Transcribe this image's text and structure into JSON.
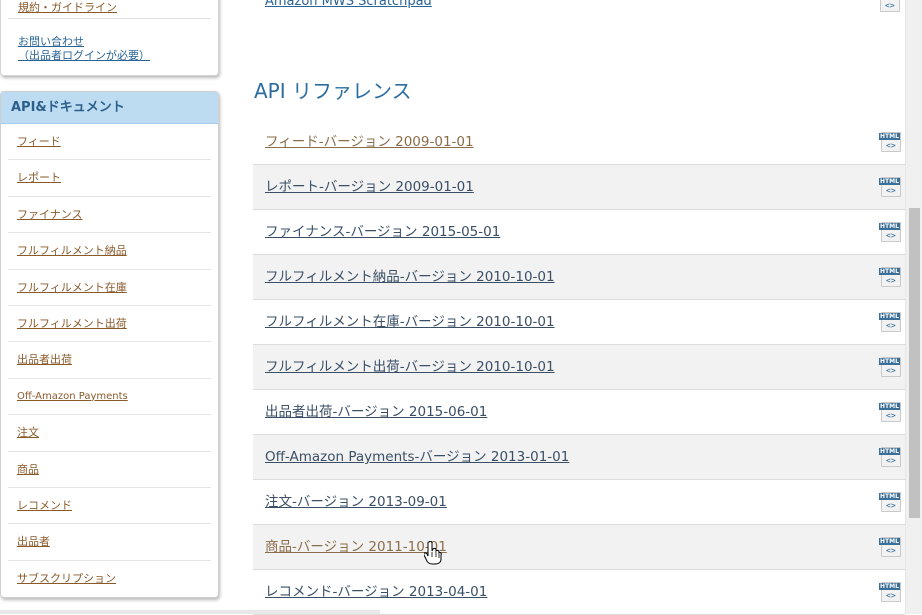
{
  "sidebar": {
    "top_link": "規約・ガイドライン",
    "contact_line1": "お問い合わせ",
    "contact_line2": "（出品者ログインが必要）",
    "section_title": "API&ドキュメント",
    "items": [
      {
        "label": "フィード"
      },
      {
        "label": "レポート"
      },
      {
        "label": "ファイナンス"
      },
      {
        "label": "フルフィルメント納品"
      },
      {
        "label": "フルフィルメント在庫"
      },
      {
        "label": "フルフィルメント出荷"
      },
      {
        "label": "出品者出荷"
      },
      {
        "label": "Off-Amazon Payments"
      },
      {
        "label": "注文"
      },
      {
        "label": "商品"
      },
      {
        "label": "レコメンド"
      },
      {
        "label": "出品者"
      },
      {
        "label": "サブスクリプション"
      }
    ]
  },
  "main": {
    "prev_link": "Amazon MWS Scratchpad",
    "section_title": "API リファレンス",
    "icon_tag": "HTML",
    "icon_code": "<>",
    "api_list": [
      {
        "label": "フィード-バージョン 2009-01-01"
      },
      {
        "label": "レポート-バージョン 2009-01-01"
      },
      {
        "label": "ファイナンス-バージョン 2015-05-01"
      },
      {
        "label": "フルフィルメント納品-バージョン 2010-10-01"
      },
      {
        "label": "フルフィルメント在庫-バージョン 2010-10-01"
      },
      {
        "label": "フルフィルメント出荷-バージョン 2010-10-01"
      },
      {
        "label": "出品者出荷-バージョン 2015-06-01"
      },
      {
        "label": "Off-Amazon Payments-バージョン 2013-01-01"
      },
      {
        "label": "注文-バージョン 2013-09-01"
      },
      {
        "label": "商品-バージョン 2011-10-01"
      },
      {
        "label": "レコメンド-バージョン 2013-04-01"
      }
    ]
  },
  "colors": {
    "link_brown": "#8a5a2b",
    "link_blue": "#2a6496",
    "sidebar_header_bg": "#bddcf2",
    "row_alt_bg": "#f2f2f2"
  }
}
